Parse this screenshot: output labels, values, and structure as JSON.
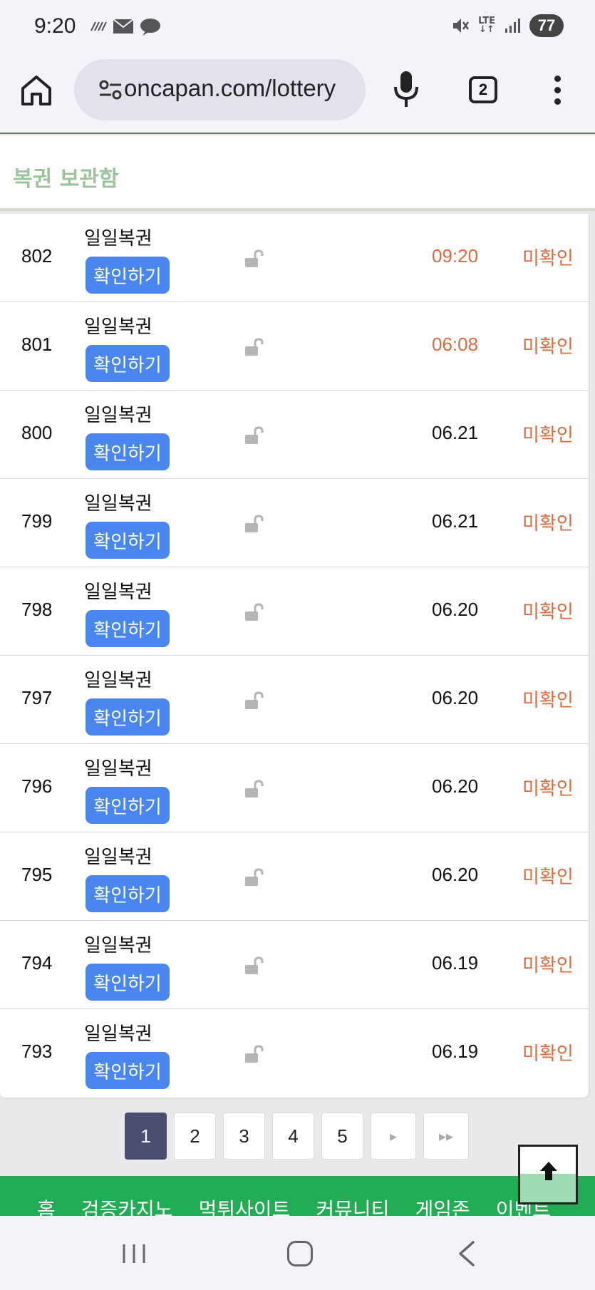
{
  "status_bar": {
    "time": "9:20",
    "battery": "77",
    "network": "LTE"
  },
  "browser": {
    "url": "oncapan.com/lottery",
    "tab_count": "2"
  },
  "page": {
    "title": "복권 보관함"
  },
  "rows": [
    {
      "num": "802",
      "name": "일일복권",
      "button": "확인하기",
      "date": "09:20",
      "recent": true,
      "status": "미확인"
    },
    {
      "num": "801",
      "name": "일일복권",
      "button": "확인하기",
      "date": "06:08",
      "recent": true,
      "status": "미확인"
    },
    {
      "num": "800",
      "name": "일일복권",
      "button": "확인하기",
      "date": "06.21",
      "recent": false,
      "status": "미확인"
    },
    {
      "num": "799",
      "name": "일일복권",
      "button": "확인하기",
      "date": "06.21",
      "recent": false,
      "status": "미확인"
    },
    {
      "num": "798",
      "name": "일일복권",
      "button": "확인하기",
      "date": "06.20",
      "recent": false,
      "status": "미확인"
    },
    {
      "num": "797",
      "name": "일일복권",
      "button": "확인하기",
      "date": "06.20",
      "recent": false,
      "status": "미확인"
    },
    {
      "num": "796",
      "name": "일일복권",
      "button": "확인하기",
      "date": "06.20",
      "recent": false,
      "status": "미확인"
    },
    {
      "num": "795",
      "name": "일일복권",
      "button": "확인하기",
      "date": "06.20",
      "recent": false,
      "status": "미확인"
    },
    {
      "num": "794",
      "name": "일일복권",
      "button": "확인하기",
      "date": "06.19",
      "recent": false,
      "status": "미확인"
    },
    {
      "num": "793",
      "name": "일일복권",
      "button": "확인하기",
      "date": "06.19",
      "recent": false,
      "status": "미확인"
    }
  ],
  "pagination": {
    "pages": [
      "1",
      "2",
      "3",
      "4",
      "5"
    ],
    "current": "1",
    "next": "▸",
    "last": "▸▸"
  },
  "bottom_nav": {
    "items": [
      "홈",
      "검증카지노",
      "먹튀사이트",
      "커뮤니티",
      "게임존",
      "이벤트"
    ]
  },
  "colors": {
    "accent_blue": "#4a86f0",
    "status_orange": "#e06a3c",
    "nav_green": "#22ad55",
    "title_green": "#9cc39e",
    "page_active": "#4a4f71"
  }
}
